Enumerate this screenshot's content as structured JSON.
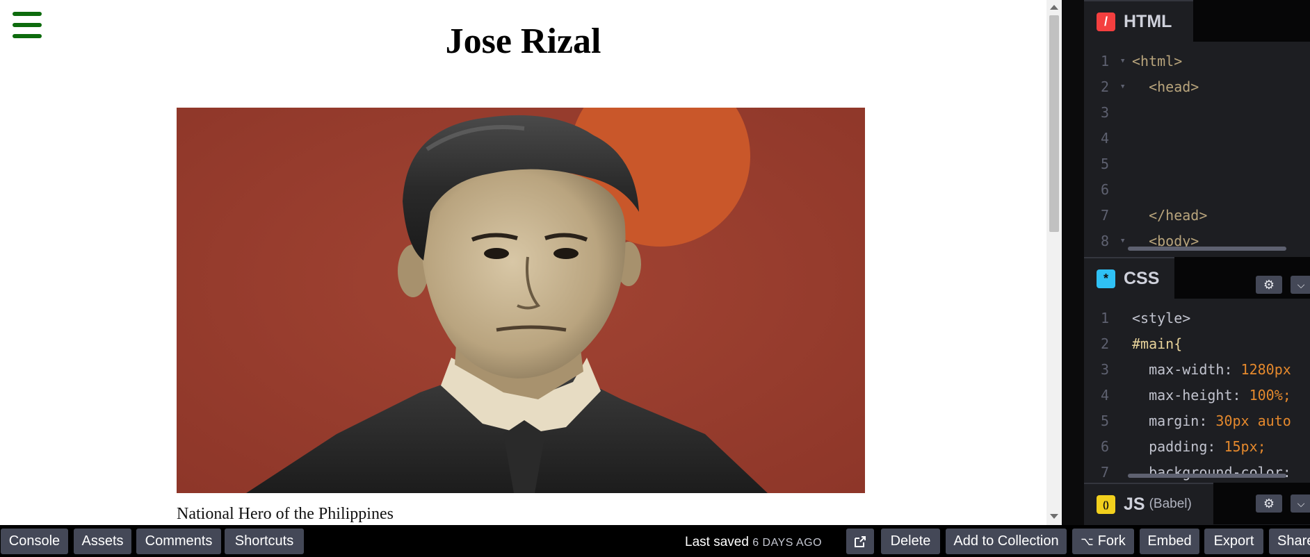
{
  "preview": {
    "menu_icon": "hamburger-icon",
    "title": "Jose Rizal",
    "caption": "National Hero of the Philippines",
    "menu_color": "#0d6b0d"
  },
  "panels": {
    "html": {
      "label": "HTML",
      "badge_glyph": "/",
      "badge_color": "#f43f3f",
      "lines": [
        {
          "n": "1",
          "fold": true,
          "text": "<html>"
        },
        {
          "n": "2",
          "fold": true,
          "text": "  <head>"
        },
        {
          "n": "3",
          "fold": false,
          "text": ""
        },
        {
          "n": "4",
          "fold": false,
          "text": ""
        },
        {
          "n": "5",
          "fold": false,
          "text": ""
        },
        {
          "n": "6",
          "fold": false,
          "text": ""
        },
        {
          "n": "7",
          "fold": false,
          "text": "  </head>"
        },
        {
          "n": "8",
          "fold": true,
          "text": "  <body>"
        }
      ]
    },
    "css": {
      "label": "CSS",
      "badge_glyph": "*",
      "badge_color": "#2fc1f5",
      "lines": [
        {
          "n": "1",
          "text": "<style>"
        },
        {
          "n": "2",
          "text": "#main{"
        },
        {
          "n": "3",
          "prop": "  max-width",
          "val": "1280px"
        },
        {
          "n": "4",
          "prop": "  max-height",
          "val": "100%;"
        },
        {
          "n": "5",
          "prop": "  margin",
          "val": "30px auto"
        },
        {
          "n": "6",
          "prop": "  padding",
          "val": "15px;"
        },
        {
          "n": "7",
          "prop": "  background-color",
          "val": ""
        }
      ]
    },
    "js": {
      "label": "JS",
      "sublabel": "(Babel)",
      "badge_glyph": "()",
      "badge_color": "#f2d01d"
    }
  },
  "bottom_bar": {
    "console": "Console",
    "assets": "Assets",
    "comments": "Comments",
    "shortcuts": "Shortcuts",
    "last_saved": "Last saved",
    "last_saved_when": "6 DAYS AGO",
    "open_external_icon": "external-link-icon",
    "delete": "Delete",
    "add_to_collection": "Add to Collection",
    "fork": "Fork",
    "embed": "Embed",
    "export": "Export",
    "share": "Share"
  }
}
